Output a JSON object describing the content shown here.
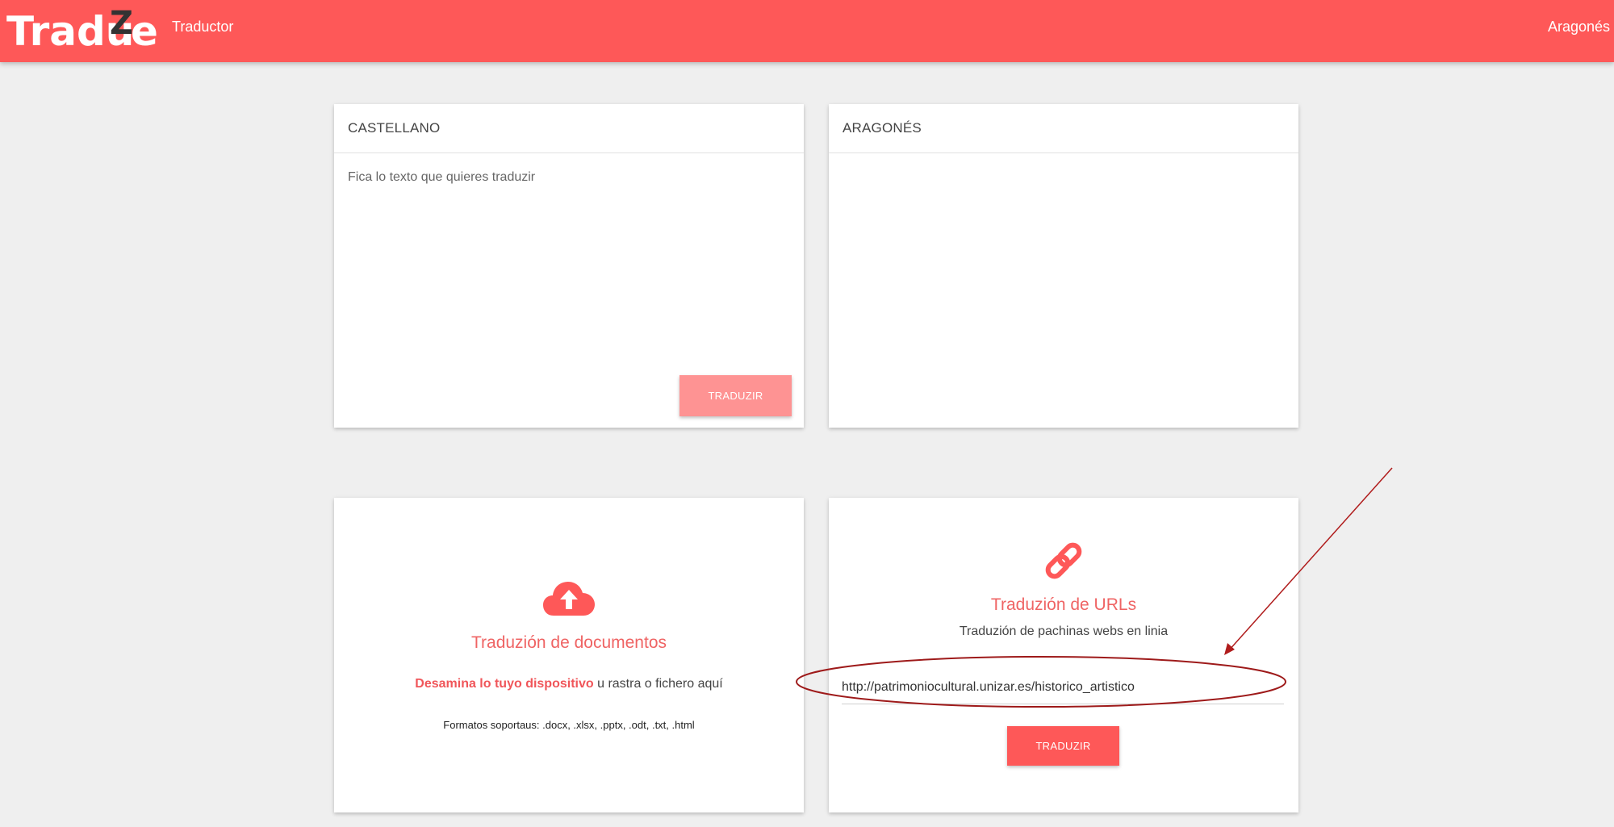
{
  "header": {
    "logo": {
      "part1": "Tradu",
      "z": "Z",
      "part2": "e"
    },
    "nav_item": "Traductor",
    "language": "Aragonés"
  },
  "source_panel": {
    "title": "CASTELLANO",
    "placeholder": "Fica lo texto que quieres traduzir",
    "button_label": "TRADUZIR"
  },
  "target_panel": {
    "title": "ARAGONÉS"
  },
  "documents_panel": {
    "icon": "cloud-upload-icon",
    "title": "Traduzión de documentos",
    "browse_link": "Desamina lo tuyo dispositivo",
    "drop_text": "u rastra o fichero aquí",
    "formats": "Formatos soportaus: .docx, .xlsx, .pptx, .odt, .txt, .html"
  },
  "url_panel": {
    "icon": "link-icon",
    "title": "Traduzión de URLs",
    "subtitle": "Traduzión de pachinas webs en linia",
    "url_value": "http://patrimoniocultural.unizar.es/historico_artistico",
    "button_label": "TRADUZIR"
  },
  "colors": {
    "brand": "#fe5858",
    "accent_text": "#ef6464",
    "annotation": "#b01c1c",
    "background": "#efefef"
  }
}
